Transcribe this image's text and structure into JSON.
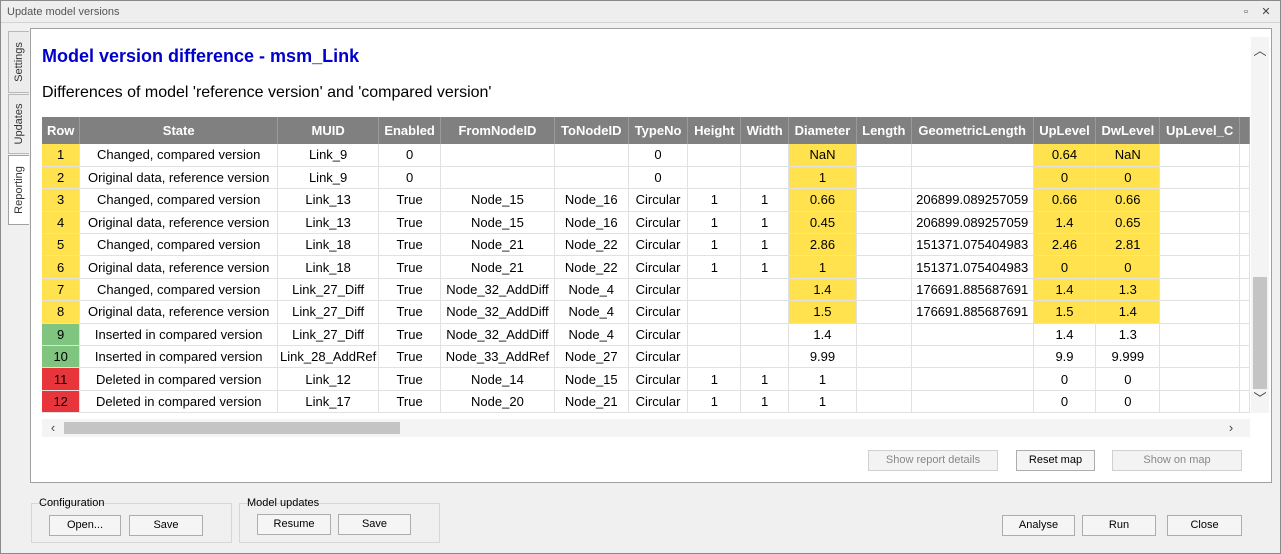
{
  "window": {
    "title": "Update model versions",
    "restore_glyph": "▫",
    "close_glyph": "✕"
  },
  "side_tabs": [
    "Settings",
    "Updates",
    "Reporting"
  ],
  "report": {
    "title": "Model version difference - msm_Link",
    "subtitle": "Differences of model 'reference version' and 'compared version'"
  },
  "table": {
    "columns": [
      "Row",
      "State",
      "MUID",
      "Enabled",
      "FromNodeID",
      "ToNodeID",
      "TypeNo",
      "Height",
      "Width",
      "Diameter",
      "Length",
      "GeometricLength",
      "UpLevel",
      "DwLevel",
      "UpLevel_C",
      ""
    ],
    "rows": [
      {
        "cells": [
          "1",
          "Changed, compared version",
          "Link_9",
          "0",
          "",
          "",
          "0",
          "",
          "",
          "NaN",
          "",
          "",
          "0.64",
          "NaN",
          "",
          ""
        ],
        "status": "yellow",
        "highlight": [
          9,
          12,
          13
        ]
      },
      {
        "cells": [
          "2",
          "Original data, reference version",
          "Link_9",
          "0",
          "",
          "",
          "0",
          "",
          "",
          "1",
          "",
          "",
          "0",
          "0",
          "",
          ""
        ],
        "status": "yellow",
        "highlight": [
          9,
          12,
          13
        ]
      },
      {
        "cells": [
          "3",
          "Changed, compared version",
          "Link_13",
          "True",
          "Node_15",
          "Node_16",
          "Circular",
          "1",
          "1",
          "0.66",
          "",
          "206899.089257059",
          "0.66",
          "0.66",
          "",
          ""
        ],
        "status": "yellow",
        "highlight": [
          9,
          12,
          13
        ]
      },
      {
        "cells": [
          "4",
          "Original data, reference version",
          "Link_13",
          "True",
          "Node_15",
          "Node_16",
          "Circular",
          "1",
          "1",
          "0.45",
          "",
          "206899.089257059",
          "1.4",
          "0.65",
          "",
          ""
        ],
        "status": "yellow",
        "highlight": [
          9,
          12,
          13
        ]
      },
      {
        "cells": [
          "5",
          "Changed, compared version",
          "Link_18",
          "True",
          "Node_21",
          "Node_22",
          "Circular",
          "1",
          "1",
          "2.86",
          "",
          "151371.075404983",
          "2.46",
          "2.81",
          "",
          ""
        ],
        "status": "yellow",
        "highlight": [
          9,
          12,
          13
        ]
      },
      {
        "cells": [
          "6",
          "Original data, reference version",
          "Link_18",
          "True",
          "Node_21",
          "Node_22",
          "Circular",
          "1",
          "1",
          "1",
          "",
          "151371.075404983",
          "0",
          "0",
          "",
          ""
        ],
        "status": "yellow",
        "highlight": [
          9,
          12,
          13
        ]
      },
      {
        "cells": [
          "7",
          "Changed, compared version",
          "Link_27_Diff",
          "True",
          "Node_32_AddDiff",
          "Node_4",
          "Circular",
          "",
          "",
          "1.4",
          "",
          "176691.885687691",
          "1.4",
          "1.3",
          "",
          ""
        ],
        "status": "yellow",
        "highlight": [
          9,
          12,
          13
        ]
      },
      {
        "cells": [
          "8",
          "Original data, reference version",
          "Link_27_Diff",
          "True",
          "Node_32_AddDiff",
          "Node_4",
          "Circular",
          "",
          "",
          "1.5",
          "",
          "176691.885687691",
          "1.5",
          "1.4",
          "",
          ""
        ],
        "status": "yellow",
        "highlight": [
          9,
          12,
          13
        ]
      },
      {
        "cells": [
          "9",
          "Inserted in compared version",
          "Link_27_Diff",
          "True",
          "Node_32_AddDiff",
          "Node_4",
          "Circular",
          "",
          "",
          "1.4",
          "",
          "",
          "1.4",
          "1.3",
          "",
          ""
        ],
        "status": "green",
        "highlight": []
      },
      {
        "cells": [
          "10",
          "Inserted in compared version",
          "Link_28_AddRef",
          "True",
          "Node_33_AddRef",
          "Node_27",
          "Circular",
          "",
          "",
          "9.99",
          "",
          "",
          "9.9",
          "9.999",
          "",
          ""
        ],
        "status": "green",
        "highlight": []
      },
      {
        "cells": [
          "11",
          "Deleted in compared version",
          "Link_12",
          "True",
          "Node_14",
          "Node_15",
          "Circular",
          "1",
          "1",
          "1",
          "",
          "",
          "0",
          "0",
          "",
          ""
        ],
        "status": "red",
        "highlight": []
      },
      {
        "cells": [
          "12",
          "Deleted in compared version",
          "Link_17",
          "True",
          "Node_20",
          "Node_21",
          "Circular",
          "1",
          "1",
          "1",
          "",
          "",
          "0",
          "0",
          "",
          ""
        ],
        "status": "red",
        "highlight": []
      }
    ]
  },
  "report_actions": {
    "show_details": "Show report details",
    "reset_map": "Reset map",
    "show_on_map": "Show on map"
  },
  "configuration": {
    "label": "Configuration",
    "open": "Open...",
    "save": "Save"
  },
  "model_updates": {
    "label": "Model updates",
    "resume": "Resume",
    "save": "Save"
  },
  "footer": {
    "analyse": "Analyse",
    "run": "Run",
    "close": "Close"
  },
  "colors": {
    "title_blue": "#0000cc",
    "changed_yellow": "#ffe24d",
    "inserted_green": "#7fc47f",
    "deleted_red": "#e8353b",
    "header_grey": "#808080"
  }
}
